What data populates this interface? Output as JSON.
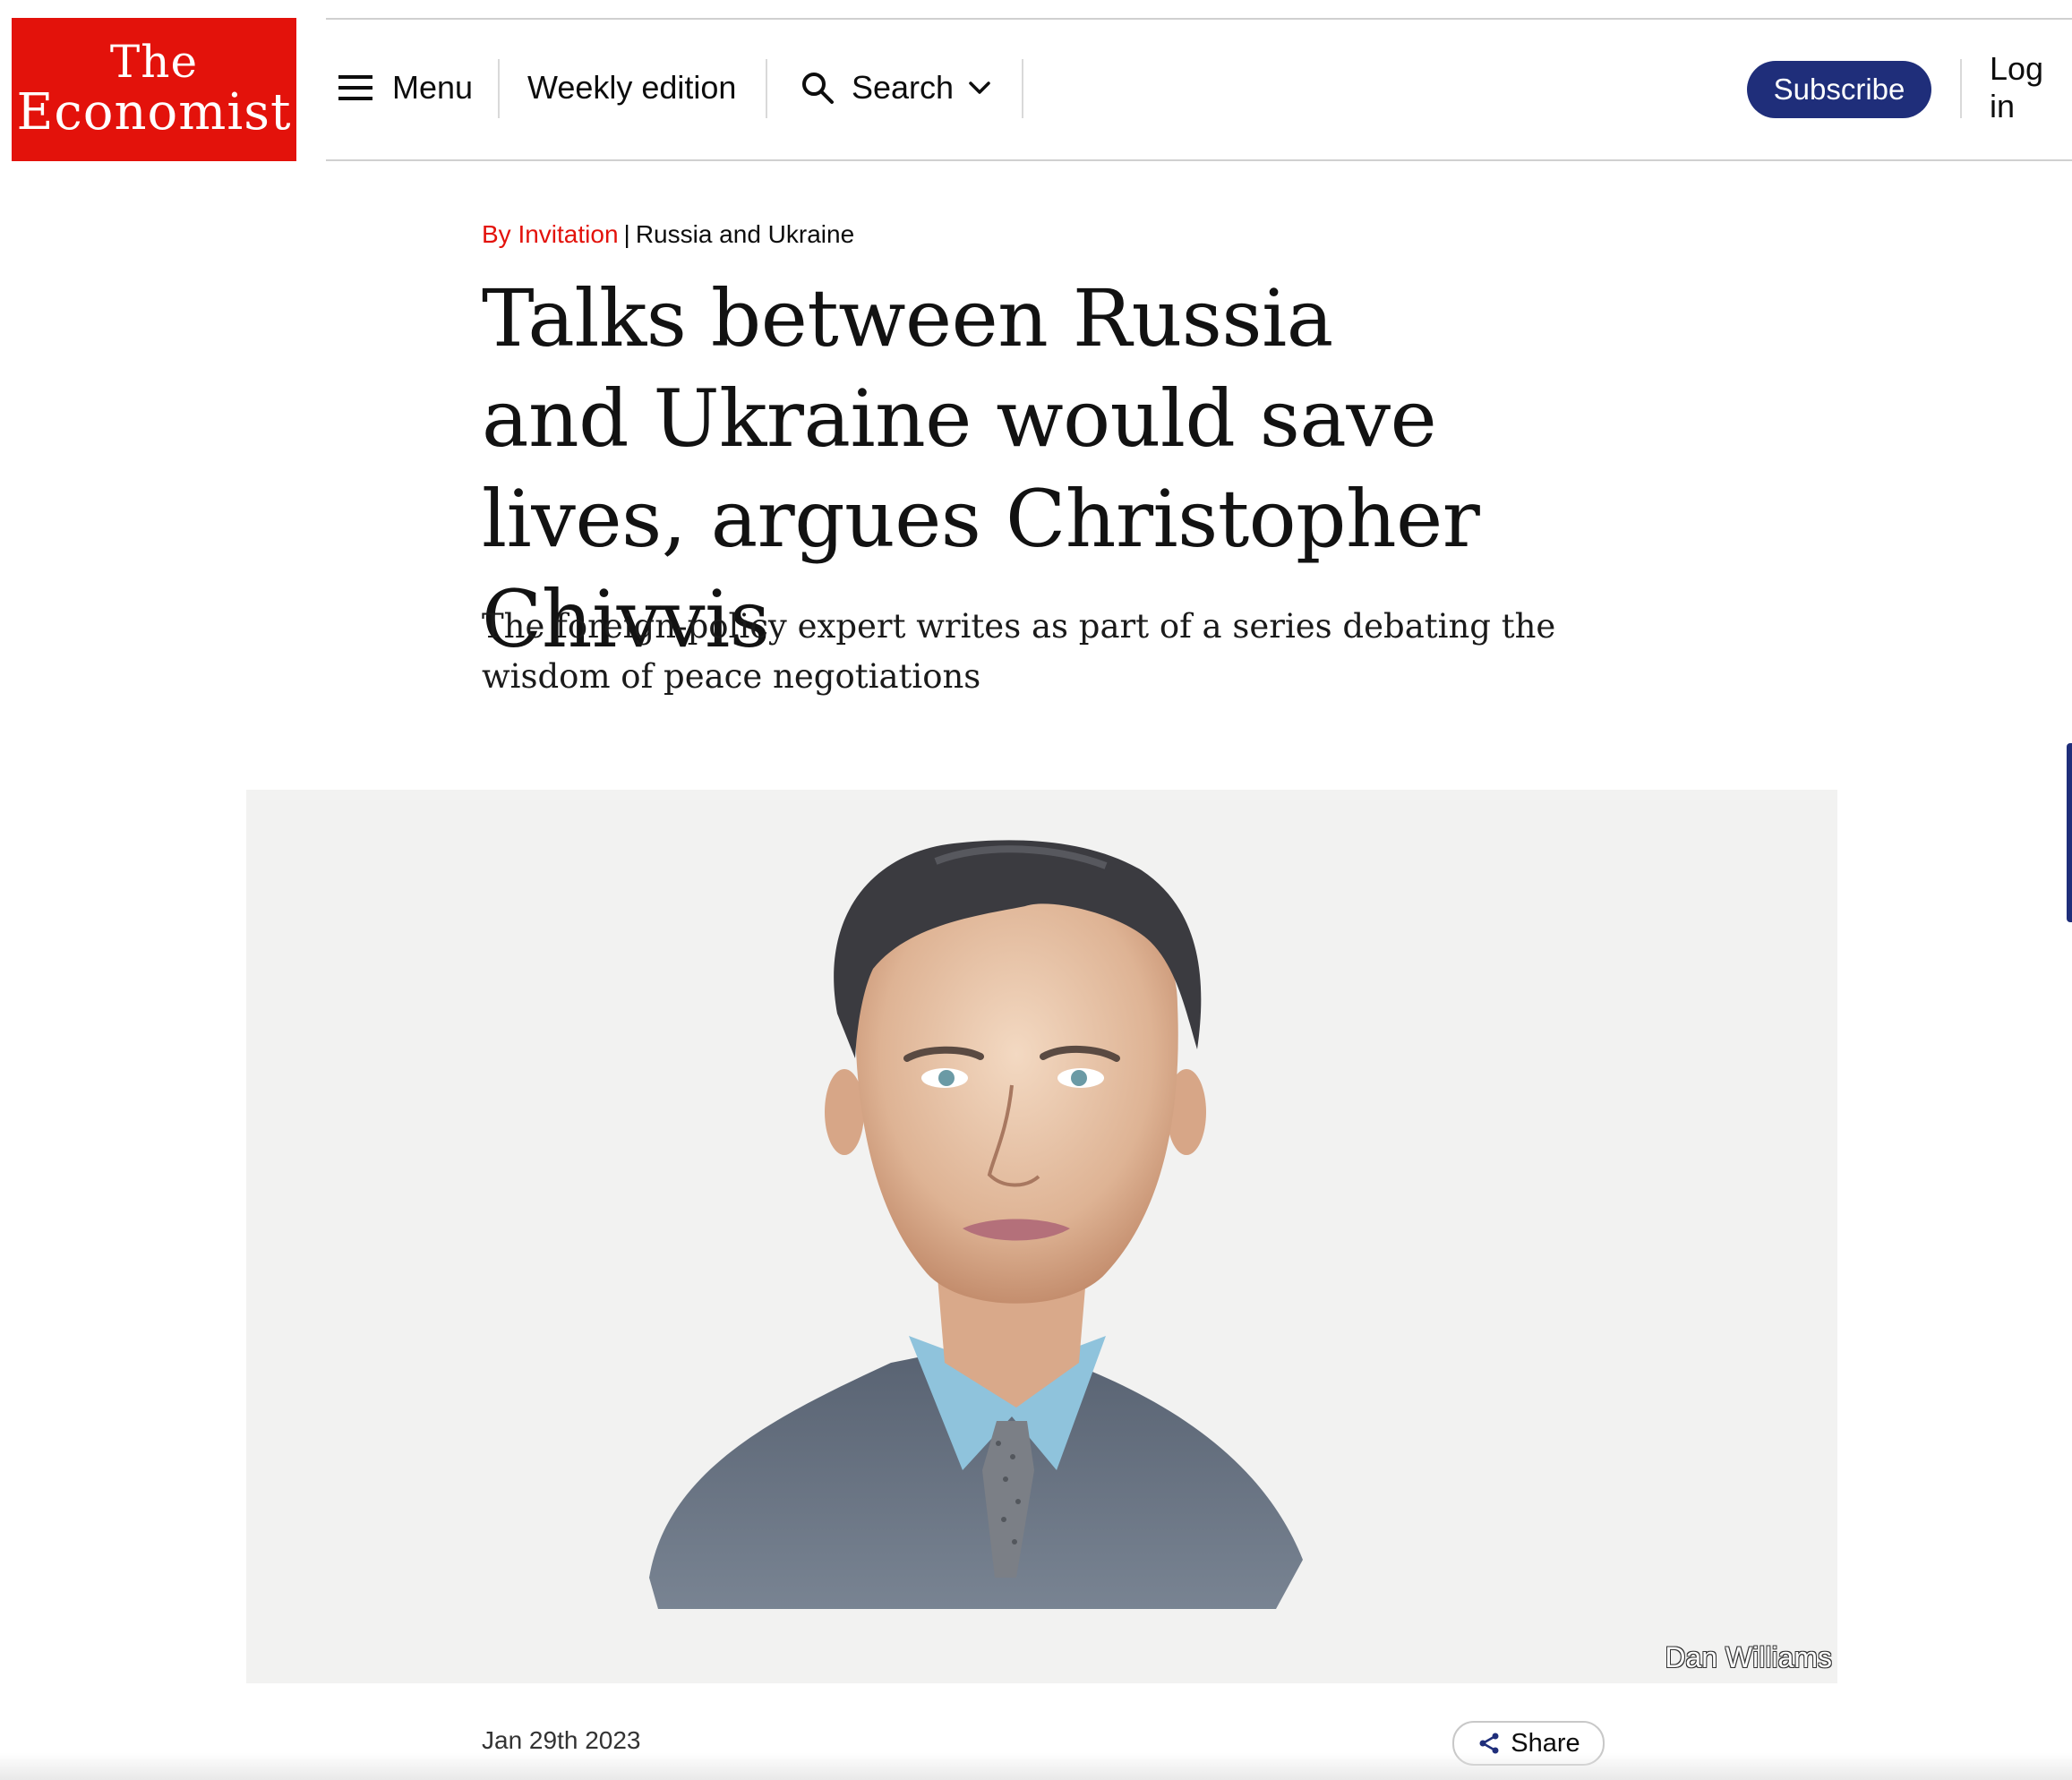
{
  "header": {
    "logo": {
      "line1": "The",
      "line2": "Economist"
    },
    "menu_label": "Menu",
    "weekly_edition_label": "Weekly edition",
    "search_label": "Search",
    "subscribe_label": "Subscribe",
    "login_label": "Log in"
  },
  "article": {
    "section": "By Invitation",
    "topic": "Russia and Ukraine",
    "headline": "Talks between Russia and Ukraine would save lives, argues Christopher Chivvis",
    "standfirst": "The foreign-policy expert writes as part of a series debating the wisdom of peace negotiations",
    "image_credit": "Dan Williams",
    "date": "Jan 29th 2023",
    "share_label": "Share"
  },
  "colors": {
    "brand_red": "#e3120b",
    "subscribe_navy": "#1f2e7a"
  },
  "icons": [
    "menu-icon",
    "search-icon",
    "chevron-down-icon",
    "share-icon"
  ]
}
